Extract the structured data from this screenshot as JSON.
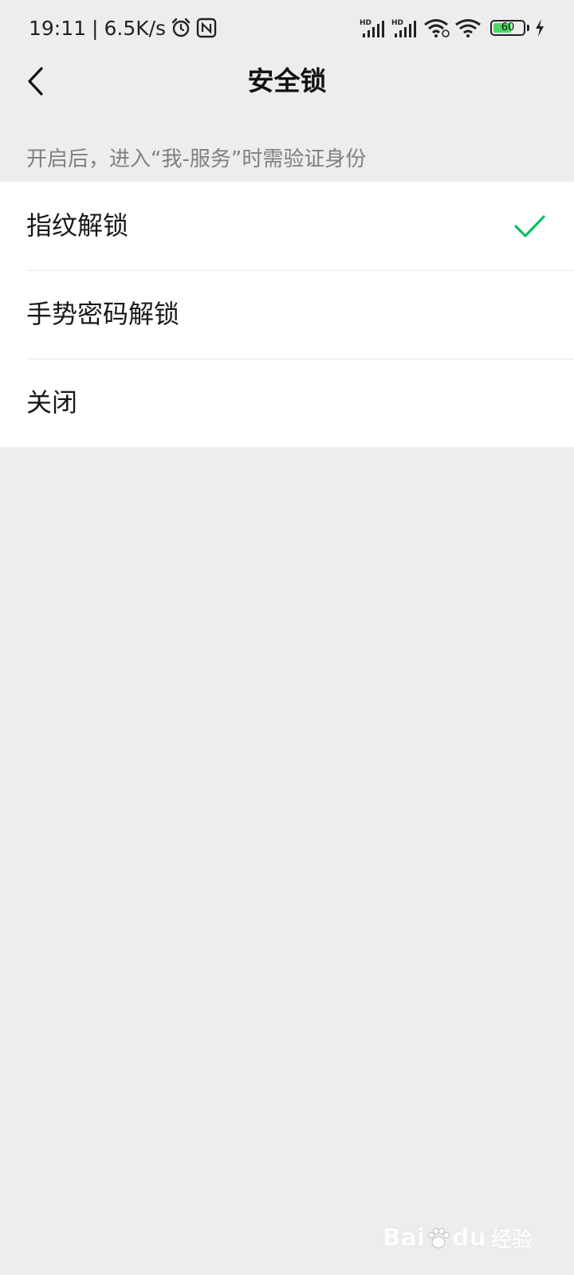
{
  "status_bar": {
    "time": "19:11",
    "separator": "|",
    "net_speed": "6.5K/s",
    "icons_left": [
      "alarm-icon",
      "nfc-icon"
    ],
    "icons_right": [
      "hd-signal-icon",
      "hd-signal-icon",
      "wifi-link-icon",
      "wifi-icon",
      "battery-icon",
      "charging-icon"
    ],
    "battery_level": "60",
    "battery_fraction": 0.6,
    "battery_color": "#4cd964"
  },
  "header": {
    "title": "安全锁",
    "back_icon": "chevron-left-icon"
  },
  "hint": "开启后，进入“我-服务”时需验证身份",
  "options": [
    {
      "label": "指纹解锁",
      "selected": true
    },
    {
      "label": "手势密码解锁",
      "selected": false
    },
    {
      "label": "关闭",
      "selected": false
    }
  ],
  "accent_color": "#07c160",
  "watermark": {
    "brand": "Bai",
    "brand2": "du",
    "suffix": "经验",
    "url": "jingyan.baidu.com"
  }
}
